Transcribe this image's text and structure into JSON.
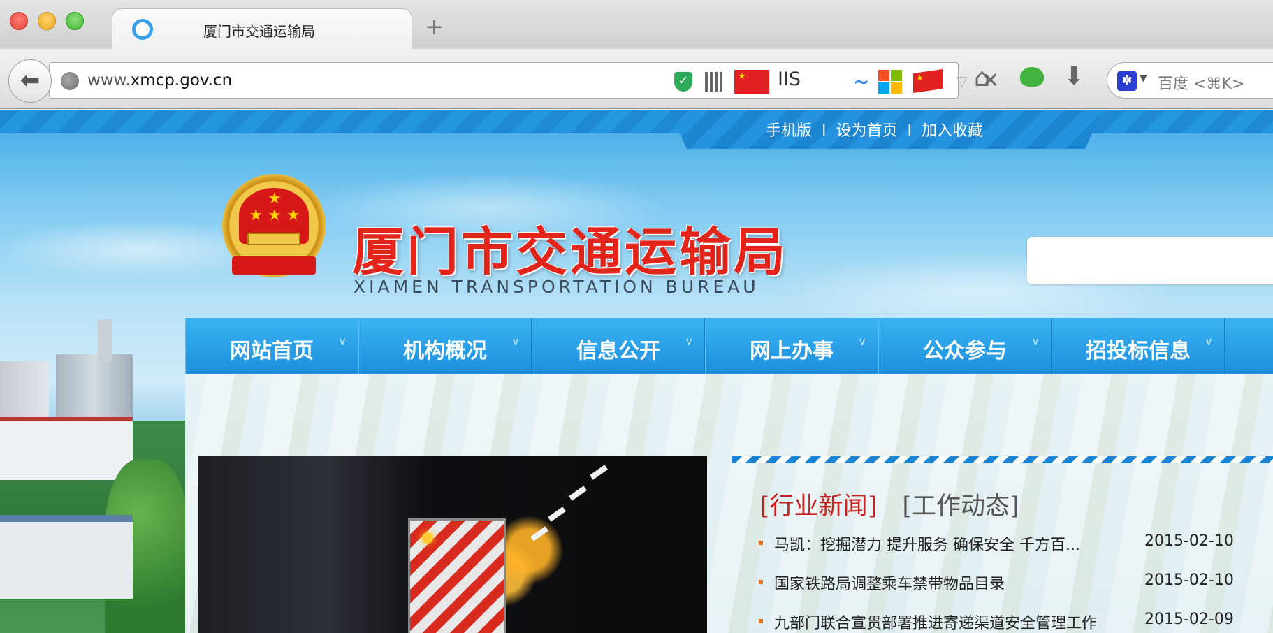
{
  "browser": {
    "tab_title": "厦门市交通运输局",
    "new_tab": "+",
    "url_prefix": "www.",
    "url_domain": "xmcp.gov.cn",
    "ext_iis": "IIS",
    "search_placeholder": "百度 <⌘K>"
  },
  "site": {
    "top_links": [
      "手机版",
      "设为首页",
      "加入收藏"
    ],
    "separator": "I",
    "title": "厦门市交通运输局",
    "subtitle": "XIAMEN TRANSPORTATION BUREAU",
    "nav": [
      "网站首页",
      "机构概况",
      "信息公开",
      "网上办事",
      "公众参与",
      "招投标信息"
    ],
    "news_tabs": [
      "[行业新闻]",
      "[工作动态]"
    ],
    "news": [
      {
        "title": "马凯：挖掘潜力 提升服务 确保安全 千方百...",
        "date": "2015-02-10"
      },
      {
        "title": "国家铁路局调整乘车禁带物品目录",
        "date": "2015-02-10"
      },
      {
        "title": "九部门联合宣贯部署推进寄递渠道安全管理工作",
        "date": "2015-02-09"
      }
    ]
  },
  "colors": {
    "accent_blue": "#1d8fdd",
    "title_red": "#e3241b",
    "news_tab_active": "#c81f1f",
    "bullet_orange": "#e4731c"
  },
  "icons": [
    "back-arrow-icon",
    "globe-icon",
    "shield-icon",
    "qr-code-icon",
    "china-flag-icon",
    "iis-icon",
    "wave-icon",
    "windows-logo-icon",
    "flag-icon",
    "dropdown-icon",
    "close-icon",
    "home-icon",
    "frog-icon",
    "download-icon",
    "baidu-paw-icon",
    "chevron-down-icon"
  ]
}
